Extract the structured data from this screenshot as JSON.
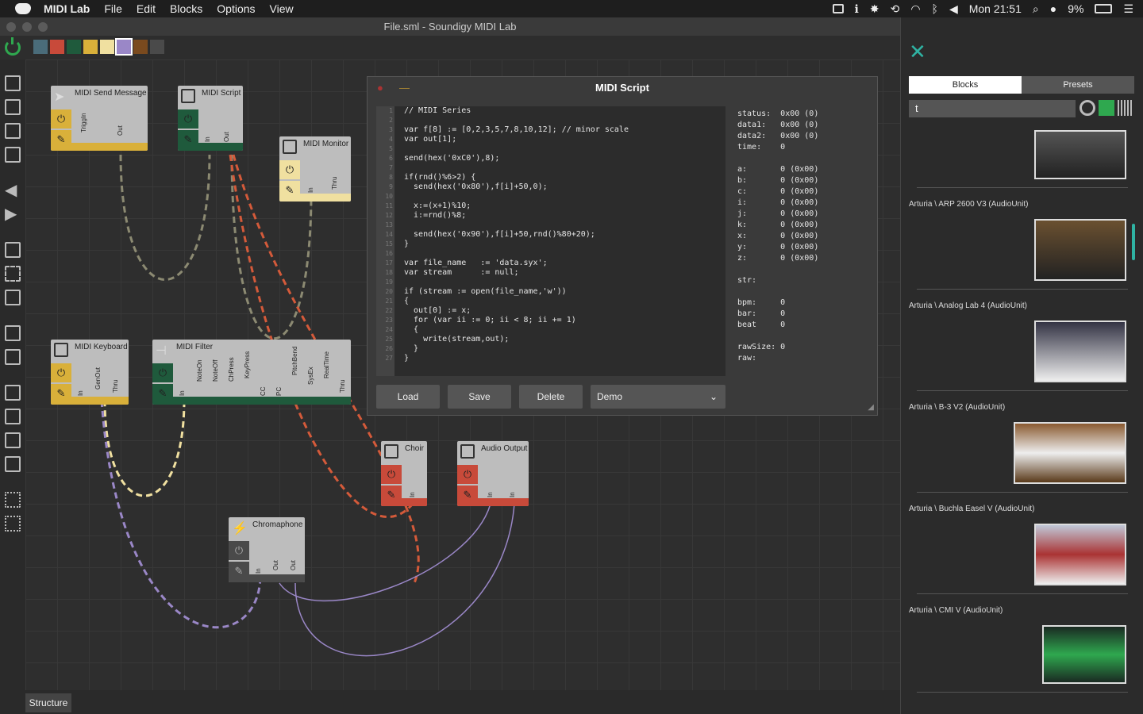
{
  "menubar": {
    "app": "MIDI Lab",
    "items": [
      "File",
      "Edit",
      "Blocks",
      "Options",
      "View"
    ],
    "clock": "Mon 21:51",
    "battery": "9%"
  },
  "window": {
    "title": "File.sml - Soundigy MIDI Lab"
  },
  "palette": [
    "#4a6c7a",
    "#c84a3a",
    "#1f5a3c",
    "#d9b03a",
    "#f0e0a0",
    "#9a87c7",
    "#7a4a1e",
    "#4a4a4a"
  ],
  "nodes": [
    {
      "title": "MIDI Send Message",
      "ports": [
        "TriggIn",
        "Out"
      ]
    },
    {
      "title": "MIDI Script",
      "ports": [
        "In",
        "Out"
      ]
    },
    {
      "title": "MIDI Monitor",
      "ports": [
        "In",
        "Thru"
      ]
    },
    {
      "title": "MIDI Keyboard",
      "ports": [
        "In",
        "GenOut",
        "Thru"
      ]
    },
    {
      "title": "MIDI Filter",
      "ports": [
        "In",
        "NoteOn",
        "NoteOff",
        "ChPress",
        "KeyPress",
        "CC",
        "PC",
        "PitchBend",
        "SysEx",
        "RealTime",
        "Thru"
      ]
    },
    {
      "title": "Choir",
      "ports": [
        "In"
      ]
    },
    {
      "title": "Audio Output",
      "ports": [
        "In",
        "In"
      ]
    },
    {
      "title": "Chromaphone",
      "ports": [
        "In",
        "Out",
        "Out"
      ]
    }
  ],
  "dialog": {
    "title": "MIDI Script",
    "code": [
      "// MIDI Series",
      "",
      "var f[8] := [0,2,3,5,7,8,10,12]; // minor scale",
      "var out[1];",
      "",
      "send(hex('0xC0'),8);",
      "",
      "if(rnd()%6>2) {",
      "  send(hex('0x80'),f[i]+50,0);",
      "",
      "  x:=(x+1)%10;",
      "  i:=rnd()%8;",
      "",
      "  send(hex('0x90'),f[i]+50,rnd()%80+20);",
      "}",
      "",
      "var file_name   := 'data.syx';",
      "var stream      := null;",
      "",
      "if (stream := open(file_name,'w'))",
      "{",
      "  out[0] := x;",
      "  for (var ii := 0; ii < 8; ii += 1)",
      "  {",
      "    write(stream,out);",
      "  }",
      "}"
    ],
    "line_numbers": [
      "1",
      "2",
      "3",
      "4",
      "5",
      "6",
      "7",
      "8",
      "9",
      "10",
      "11",
      "12",
      "13",
      "14",
      "15",
      "16",
      "17",
      "18",
      "19",
      "20",
      "21",
      "22",
      "23",
      "24",
      "25",
      "26",
      "27"
    ],
    "status": "status:  0x00 (0)\ndata1:   0x00 (0)\ndata2:   0x00 (0)\ntime:    0\n\na:       0 (0x00)\nb:       0 (0x00)\nc:       0 (0x00)\ni:       0 (0x00)\nj:       0 (0x00)\nk:       0 (0x00)\nx:       0 (0x00)\ny:       0 (0x00)\nz:       0 (0x00)\n\nstr:\n\nbpm:     0\nbar:     0\nbeat     0\n\nrawSize: 0\nraw:",
    "buttons": {
      "load": "Load",
      "save": "Save",
      "delete": "Delete"
    },
    "preset": "Demo"
  },
  "panel": {
    "tabs": [
      "Blocks",
      "Presets"
    ],
    "search_value": "t",
    "instruments": [
      "Arturia \\ ARP 2600 V3 (AudioUnit)",
      "Arturia \\ Analog Lab 4 (AudioUnit)",
      "Arturia \\ B-3 V2 (AudioUnit)",
      "Arturia \\ Buchla Easel V (AudioUnit)",
      "Arturia \\ CMI V (AudioUnit)"
    ]
  },
  "statusbar": {
    "tab": "Structure"
  }
}
